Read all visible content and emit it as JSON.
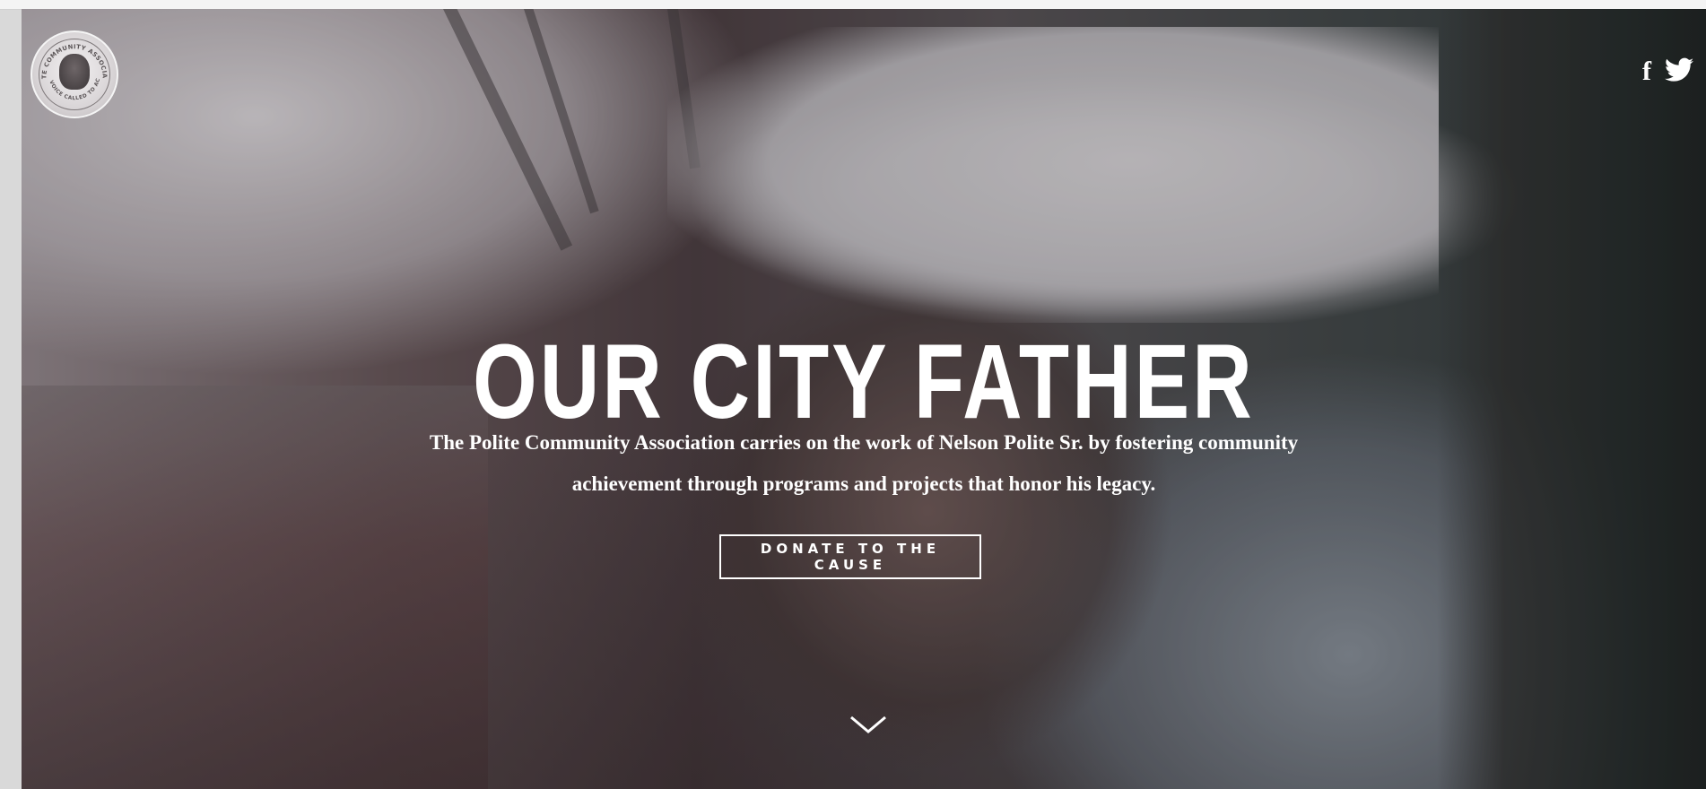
{
  "hero": {
    "headline": "OUR CITY FATHER",
    "subtext": "The Polite Community Association carries on the work of Nelson Polite Sr. by fostering community achievement through programs and projects that honor his legacy.",
    "cta_label": "DONATE TO THE CAUSE"
  },
  "logo": {
    "ring_text_top": "POLITE COMMUNITY ASSOCIATION",
    "ring_text_bottom": "A VOICE CALLED TO ACT"
  },
  "social": {
    "facebook_icon": "facebook-icon",
    "twitter_icon": "twitter-icon",
    "facebook_glyph": "f"
  },
  "colors": {
    "text": "#ffffff",
    "button_border": "#ffffff"
  }
}
